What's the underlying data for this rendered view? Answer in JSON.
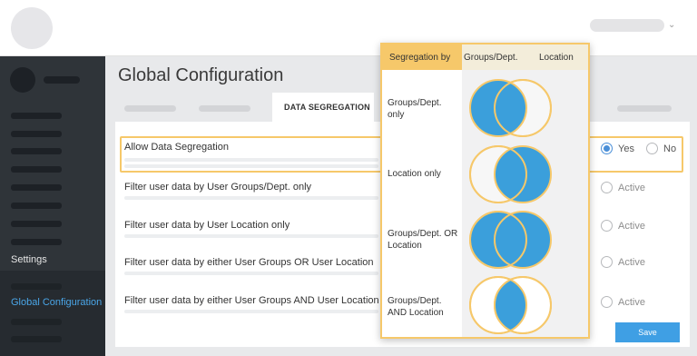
{
  "header": {},
  "sidebar": {
    "settings_label": "Settings",
    "active_item_label": "Global Configuration"
  },
  "main": {
    "title": "Global Configuration",
    "tabs": {
      "active_label": "DATA SEGREGATION"
    },
    "rows": [
      {
        "label": "Allow Data Segregation"
      },
      {
        "label": "Filter user data by User Groups/Dept. only"
      },
      {
        "label": "Filter user data by User Location only"
      },
      {
        "label": "Filter user data by either User Groups OR User Location"
      },
      {
        "label": "Filter user data by either User Groups AND User Location"
      }
    ],
    "allow_options": {
      "yes": "Yes",
      "no": "No",
      "selected": "Yes"
    },
    "active_label": "Active",
    "save_label": "Save"
  },
  "overlay": {
    "headers": {
      "segregation": "Segregation by",
      "groups": "Groups/Dept.",
      "location": "Location"
    },
    "rows": [
      {
        "label": "Groups/Dept. only",
        "venn": "left"
      },
      {
        "label": "Location only",
        "venn": "right"
      },
      {
        "label": "Groups/Dept. OR Location",
        "venn": "union"
      },
      {
        "label": "Groups/Dept. AND Location",
        "venn": "intersection"
      }
    ]
  },
  "colors": {
    "accent": "#3f9fe4",
    "venn_fill": "#3b9fdb",
    "venn_stroke": "#f6c86a",
    "sidebar_bg": "#2f3439"
  }
}
